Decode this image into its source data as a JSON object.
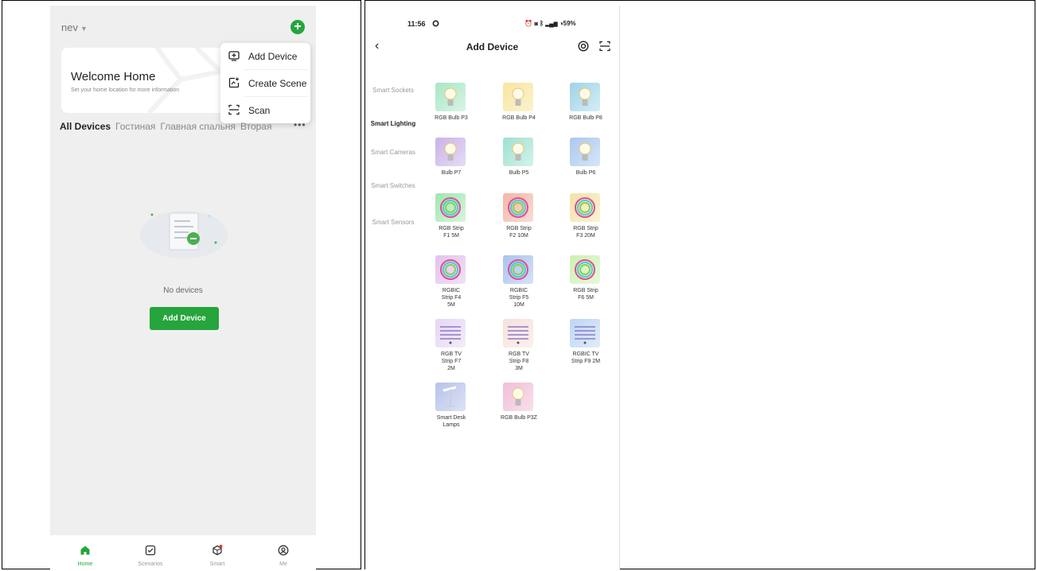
{
  "screen1": {
    "home_name": "nev",
    "welcome_title": "Welcome Home",
    "welcome_subtitle": "Set your home location for more information",
    "popup_menu": [
      {
        "label": "Add Device",
        "icon": "add-device-icon"
      },
      {
        "label": "Create Scene",
        "icon": "create-scene-icon"
      },
      {
        "label": "Scan",
        "icon": "scan-icon"
      }
    ],
    "tabs": [
      "All Devices",
      "Гостиная",
      "Главная спальня",
      "Вторая"
    ],
    "empty_text": "No devices",
    "add_button": "Add Device",
    "nav": [
      {
        "label": "Home",
        "icon": "home-icon"
      },
      {
        "label": "Scenarios",
        "icon": "scenarios-icon"
      },
      {
        "label": "Smart",
        "icon": "smart-icon"
      },
      {
        "label": "Me",
        "icon": "profile-icon"
      }
    ],
    "accent": "#25a53c"
  },
  "screen2": {
    "status_time": "11:56",
    "status_battery": "59%",
    "title": "Add Device",
    "categories": [
      {
        "label": "Smart Sockets"
      },
      {
        "label": "Smart Lighting"
      },
      {
        "label": "Smart Cameras"
      },
      {
        "label": "Smart Switches"
      },
      {
        "label": "Smart Sensors"
      }
    ],
    "active_category": "Smart Lighting",
    "devices": [
      {
        "name": "RGB Bulb P3"
      },
      {
        "name": "RGB Bulb P4"
      },
      {
        "name": "RGB Bulb P8"
      },
      {
        "name": "Bulb P7"
      },
      {
        "name": "Bulb P5"
      },
      {
        "name": "Bulb P6"
      },
      {
        "name": "RGB Strip F1 5M"
      },
      {
        "name": "RGB Strip F2 10M"
      },
      {
        "name": "RGB Strip F3 20M"
      },
      {
        "name": "RGBIC Strip F4 5M"
      },
      {
        "name": "RGBIC Strip F5 10M"
      },
      {
        "name": "RGB Strip F6 5M"
      },
      {
        "name": "RGB TV Strip F7 2M"
      },
      {
        "name": "RGB TV Strip F8 3M"
      },
      {
        "name": "RGBIC TV Strip F9 2M"
      },
      {
        "name": "Smart Desk Lamps"
      },
      {
        "name": "RGB Bulb P3Z"
      }
    ]
  }
}
